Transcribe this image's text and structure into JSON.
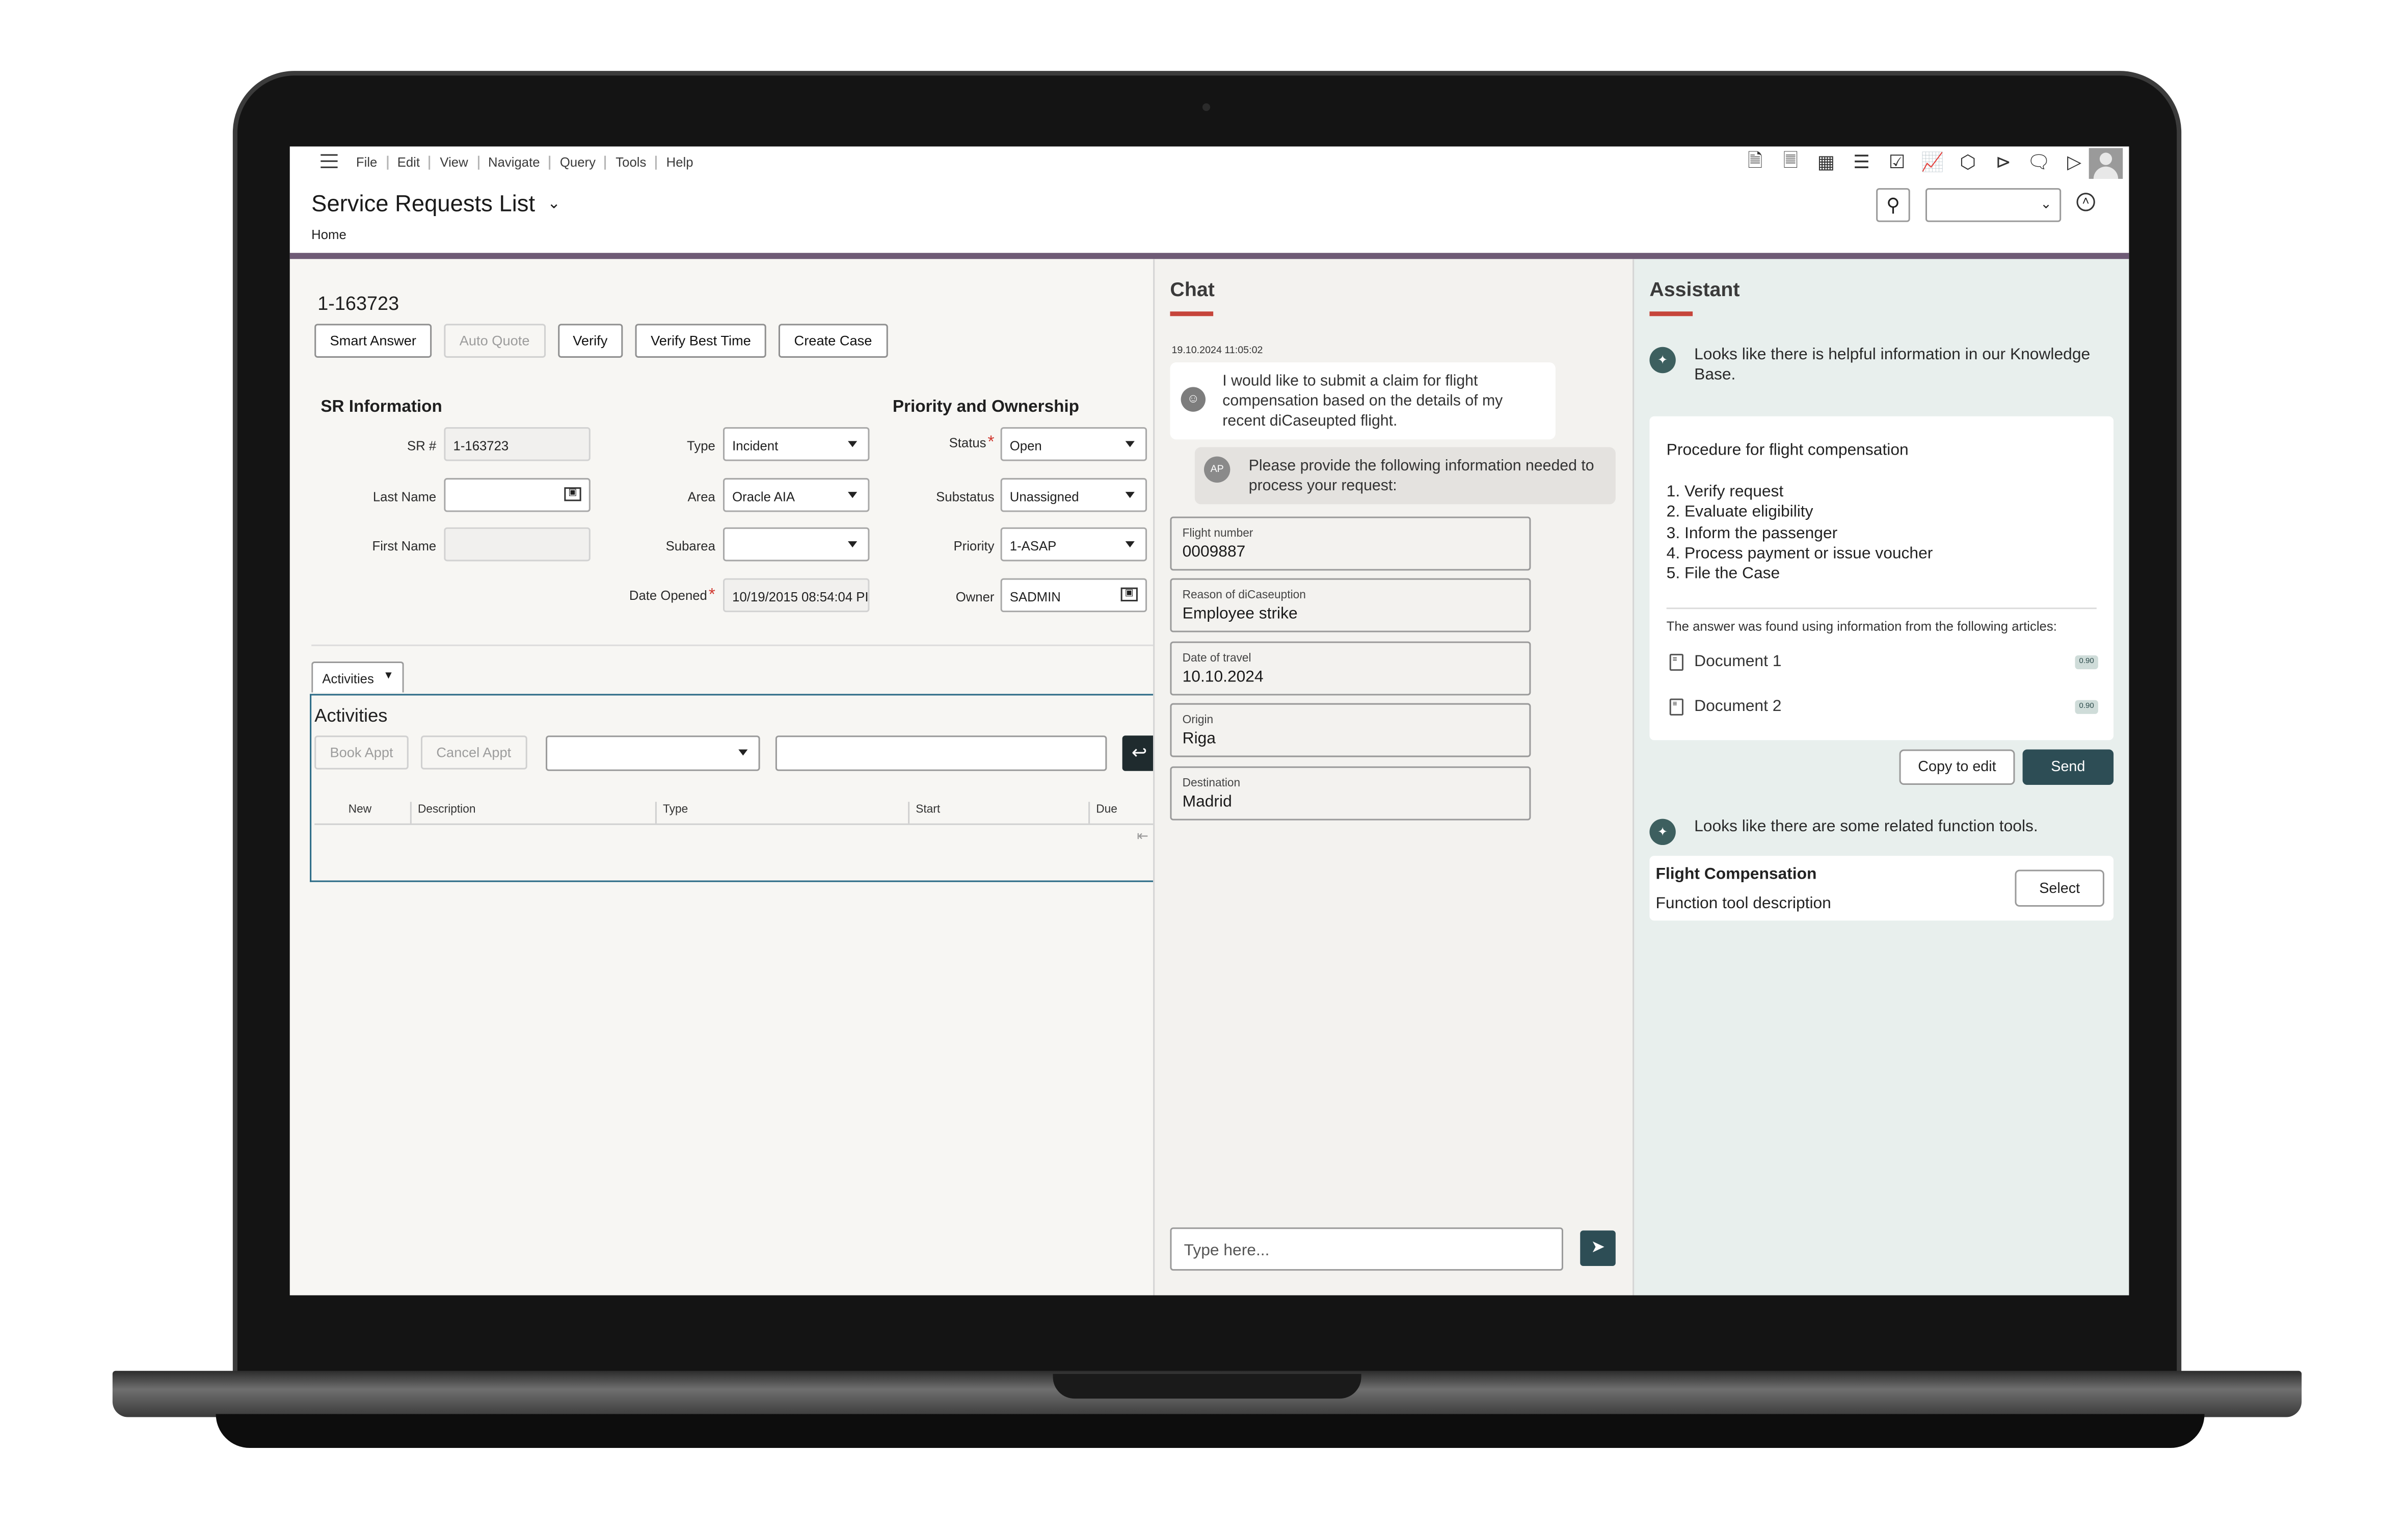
{
  "menubar": {
    "items": [
      "File",
      "Edit",
      "View",
      "Navigate",
      "Query",
      "Tools",
      "Help"
    ],
    "icons": [
      "new-doc-icon",
      "copy-doc-icon",
      "sitemap-icon",
      "list-icon",
      "checklist-icon",
      "chart-icon",
      "cube-icon",
      "share-icon",
      "comment-icon",
      "video-icon"
    ]
  },
  "header": {
    "title": "Service Requests List",
    "breadcrumb": "Home"
  },
  "record": {
    "id": "1-163723",
    "buttons": {
      "smart_answer": "Smart Answer",
      "auto_quote": "Auto Quote",
      "verify": "Verify",
      "verify_best_time": "Verify Best Time",
      "create_case": "Create Case"
    }
  },
  "sr_info": {
    "title": "SR Information",
    "sr_label": "SR #",
    "sr_value": "1-163723",
    "last_name_label": "Last Name",
    "last_name_value": "",
    "first_name_label": "First Name",
    "first_name_value": "",
    "type_label": "Type",
    "type_value": "Incident",
    "area_label": "Area",
    "area_value": "Oracle AIA",
    "subarea_label": "Subarea",
    "subarea_value": "",
    "date_opened_label": "Date Opened",
    "date_opened_value": "10/19/2015 08:54:04 PI"
  },
  "priority": {
    "title": "Priority and Ownership",
    "status_label": "Status",
    "status_value": "Open",
    "substatus_label": "Substatus",
    "substatus_value": "Unassigned",
    "priority_label": "Priority",
    "priority_value": "1-ASAP",
    "owner_label": "Owner",
    "owner_value": "SADMIN"
  },
  "activities": {
    "tab_label": "Activities",
    "title": "Activities",
    "book_appt": "Book Appt",
    "cancel_appt": "Cancel Appt",
    "columns": [
      "New",
      "Description",
      "Type",
      "Start",
      "Due"
    ]
  },
  "chat": {
    "title": "Chat",
    "timestamp": "19.10.2024 11:05:02",
    "user_message": "I would like to submit a claim for flight compensation based on the details of my recent diCaseupted flight.",
    "agent_initials": "AP",
    "agent_message": "Please provide the following information needed to process your request:",
    "fields": [
      {
        "label": "Flight number",
        "value": "0009887"
      },
      {
        "label": "Reason of diCaseuption",
        "value": "Employee strike"
      },
      {
        "label": "Date of travel",
        "value": "10.10.2024"
      },
      {
        "label": "Origin",
        "value": "Riga"
      },
      {
        "label": "Destination",
        "value": "Madrid"
      }
    ],
    "input_placeholder": "Type here..."
  },
  "assistant": {
    "title": "Assistant",
    "kb_message": "Looks like there is helpful information in our Knowledge Base.",
    "procedure_title": "Procedure for flight compensation",
    "steps": [
      "1. Verify request",
      "2. Evaluate eligibility",
      "3. Inform the passenger",
      "4. Process payment or issue voucher",
      "5. File the Case"
    ],
    "found_text": "The answer was found using information from the following articles:",
    "documents": [
      {
        "name": "Document 1",
        "score": "0.90"
      },
      {
        "name": "Document 2",
        "score": "0.90"
      }
    ],
    "copy_to_edit": "Copy to edit",
    "send": "Send",
    "tools_message": "Looks like there are some related function tools.",
    "tool_name": "Flight Compensation",
    "tool_description": "Function tool description",
    "select": "Select"
  },
  "colors": {
    "accent_bar": "#6e5a75",
    "tab_underline": "#c6453b",
    "send_button": "#2d4d55",
    "assistant_bg": "#e8efed"
  }
}
